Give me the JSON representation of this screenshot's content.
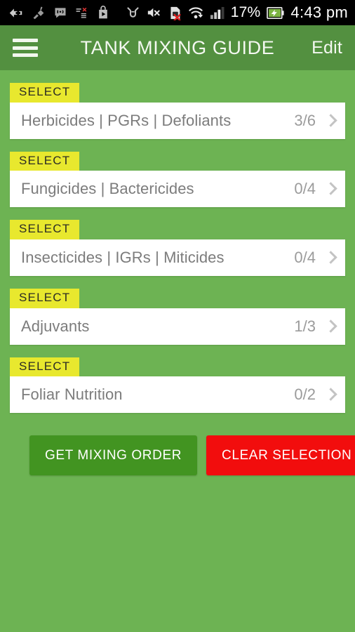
{
  "status_bar": {
    "battery_percent": "17%",
    "clock": "4:43 pm",
    "icons": [
      "arrow-back-plus-icon",
      "broken-plug-icon",
      "chat-bubble-icon",
      "list-error-icon",
      "play-store-bag-icon",
      "developer-mode-icon",
      "volume-muted-icon",
      "sim-card-error-icon",
      "wifi-download-icon",
      "cellular-signal-icon",
      "battery-charging-icon"
    ]
  },
  "app_bar": {
    "menu_icon": "hamburger-menu-icon",
    "title": "TANK MIXING GUIDE",
    "action_label": "Edit"
  },
  "colors": {
    "app_bar_green": "#539040",
    "body_green": "#6db353",
    "badge_yellow": "#e8e82e",
    "primary_button_green": "#429421",
    "danger_button_red": "#f20d0d",
    "card_white": "#ffffff",
    "card_text_gray": "#7c7c7c"
  },
  "categories": [
    {
      "badge": "SELECT",
      "label": "Herbicides | PGRs | Defoliants",
      "count": "3/6",
      "chevron": "chevron-right-icon"
    },
    {
      "badge": "SELECT",
      "label": "Fungicides | Bactericides",
      "count": "0/4",
      "chevron": "chevron-right-icon"
    },
    {
      "badge": "SELECT",
      "label": "Insecticides | IGRs | Miticides",
      "count": "0/4",
      "chevron": "chevron-right-icon"
    },
    {
      "badge": "SELECT",
      "label": "Adjuvants",
      "count": "1/3",
      "chevron": "chevron-right-icon"
    },
    {
      "badge": "SELECT",
      "label": "Foliar Nutrition",
      "count": "0/2",
      "chevron": "chevron-right-icon"
    }
  ],
  "actions": {
    "primary_label": "GET MIXING ORDER",
    "danger_label": "CLEAR SELECTION"
  }
}
